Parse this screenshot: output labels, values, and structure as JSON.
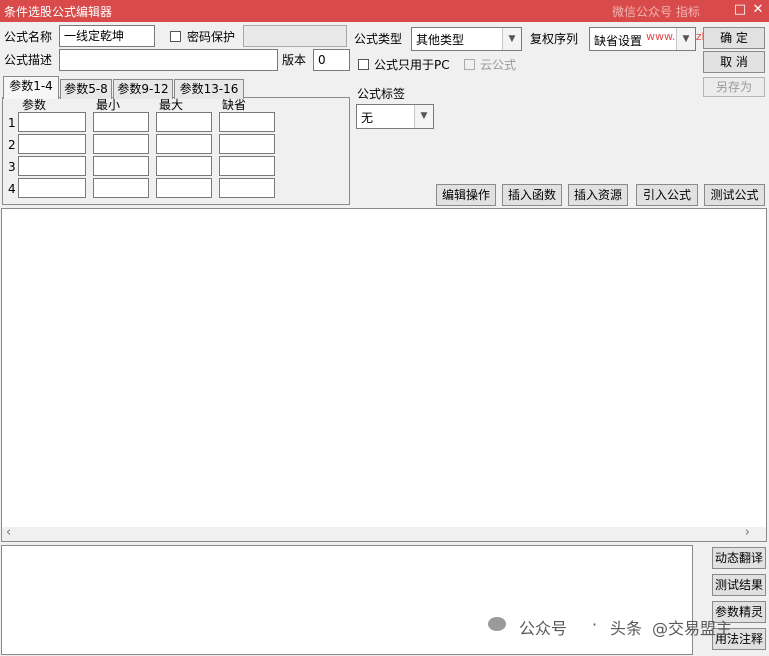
{
  "window": {
    "title": "条件选股公式编辑器",
    "watermark_top": "微信公众号 指标",
    "watermark_url": "www.xuezhibiao.com",
    "controls": {
      "restore": "□",
      "close": "✕"
    }
  },
  "form": {
    "formula_name_label": "公式名称",
    "formula_name_value": "一线定乾坤",
    "password_label": "密码保护",
    "password_value": "",
    "formula_desc_label": "公式描述",
    "formula_desc_value": "",
    "version_label": "版本",
    "version_value": "0",
    "formula_type_label": "公式类型",
    "formula_type_value": "其他类型",
    "adjust_label": "复权序列",
    "adjust_value": "缺省设置",
    "pc_only_label": "公式只用于PC",
    "cloud_label": "云公式",
    "tag_label": "公式标签",
    "tag_value": "无"
  },
  "buttons": {
    "ok": "确 定",
    "cancel": "取 消",
    "save_as": "另存为",
    "edit_ops": "编辑操作",
    "insert_func": "插入函数",
    "insert_res": "插入资源",
    "import_formula": "引入公式",
    "test_formula": "测试公式",
    "dyn_translate": "动态翻译",
    "test_result": "测试结果",
    "param_wizard": "参数精灵",
    "usage_notes": "用法注释"
  },
  "param_tabs": [
    "参数1-4",
    "参数5-8",
    "参数9-12",
    "参数13-16"
  ],
  "param_table": {
    "headers": [
      "参数",
      "最小",
      "最大",
      "缺省"
    ],
    "rows": [
      "1",
      "2",
      "3",
      "4"
    ]
  },
  "scroll": {
    "left": "‹",
    "right": "›"
  },
  "bottom_watermark": {
    "brand": "公众号",
    "separator": "·",
    "brand2": "头条",
    "handle": "@交易盟主"
  }
}
